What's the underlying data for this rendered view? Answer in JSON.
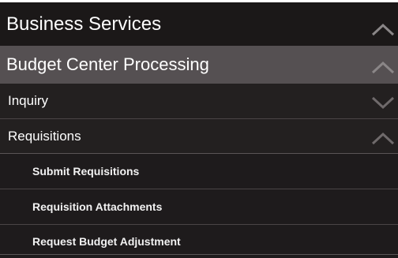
{
  "menu": {
    "header": {
      "label": "Business Services",
      "icon": "chevron-up-icon"
    },
    "section": {
      "label": "Budget Center Processing",
      "icon": "chevron-up-icon"
    },
    "items": [
      {
        "label": "Inquiry",
        "icon": "chevron-down-icon"
      },
      {
        "label": "Requisitions",
        "icon": "chevron-up-icon"
      }
    ],
    "sub_items": [
      {
        "label": "Submit Requisitions"
      },
      {
        "label": "Requisition Attachments"
      },
      {
        "label": "Request Budget Adjustment"
      }
    ]
  },
  "colors": {
    "background": "#232020",
    "highlight": "#555052",
    "text": "#ffffff",
    "chevron": "#8a8687"
  }
}
